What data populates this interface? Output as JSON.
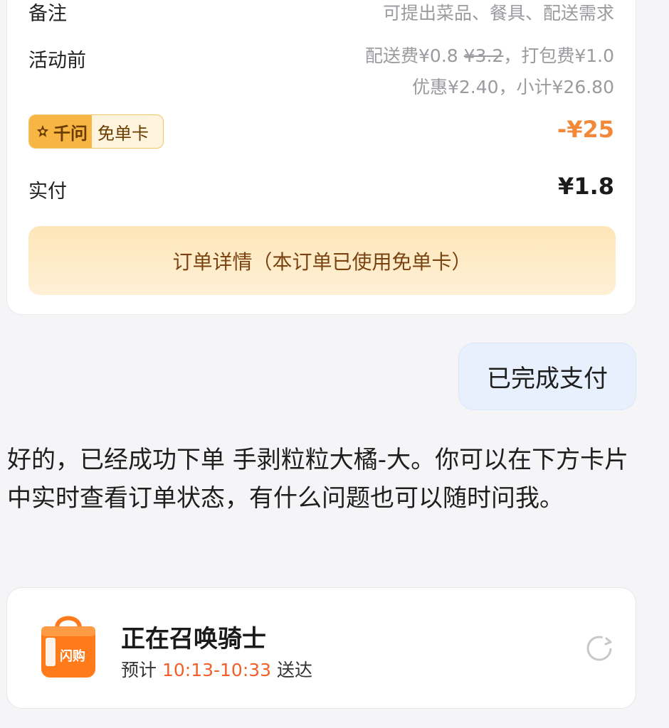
{
  "order_card": {
    "remark_label": "备注",
    "remark_placeholder": "可提出菜品、餐具、配送需求",
    "pre_activity_label": "活动前",
    "fees": {
      "delivery_label": "配送费",
      "delivery_price": "¥0.8",
      "delivery_original": "¥3.2",
      "packing": "，打包费¥1.0",
      "discount_subtotal": "优惠¥2.40，小计¥26.80"
    },
    "badge": {
      "brand": "千问",
      "card": "免单卡"
    },
    "discount_amount": "-¥25",
    "paid_label": "实付",
    "paid_amount": "¥1.8",
    "detail_button": "订单详情（本订单已使用免单卡）"
  },
  "user_message": "已完成支付",
  "assistant_reply": "好的，已经成功下单 手剥粒粒大橘-大。你可以在下方卡片中实时查看订单状态，有什么问题也可以随时问我。",
  "rider_card": {
    "bag_text": "闪购",
    "title": "正在召唤骑士",
    "eta_prefix": "预计 ",
    "eta_time": "10:13-10:33",
    "eta_suffix": " 送达"
  },
  "colors": {
    "accent_orange": "#f2893a",
    "eta_red": "#f25f2a",
    "bubble_blue": "#e8f0fd",
    "badge_gold": "#f7b544"
  },
  "icons": [
    "qianwen-star-icon",
    "shopping-bag-icon",
    "refresh-icon"
  ]
}
